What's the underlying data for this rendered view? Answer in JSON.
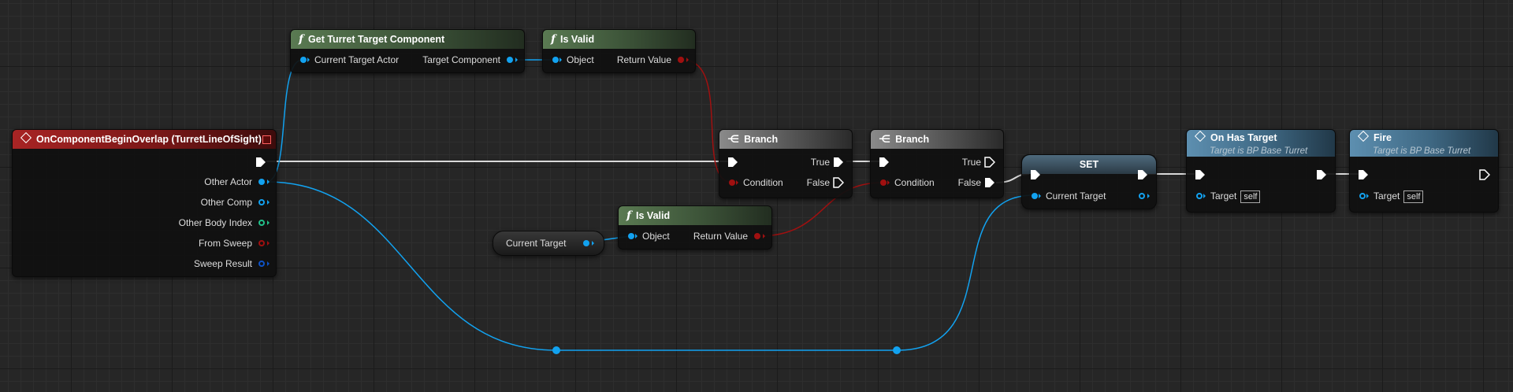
{
  "graph": {
    "event_node": {
      "title": "OnComponentBeginOverlap (TurretLineOfSight)",
      "pins": [
        "Other Actor",
        "Other Comp",
        "Other Body Index",
        "From Sweep",
        "Sweep Result"
      ]
    },
    "get_turret_target": {
      "title": "Get Turret Target Component",
      "input": "Current Target Actor",
      "output": "Target Component"
    },
    "is_valid_top": {
      "title": "Is Valid",
      "input": "Object",
      "output": "Return Value"
    },
    "is_valid_bottom": {
      "title": "Is Valid",
      "input": "Object",
      "output": "Return Value"
    },
    "current_target_var": {
      "label": "Current Target"
    },
    "branch_1": {
      "title": "Branch",
      "condition": "Condition",
      "true": "True",
      "false": "False"
    },
    "branch_2": {
      "title": "Branch",
      "condition": "Condition",
      "true": "True",
      "false": "False"
    },
    "set_node": {
      "title": "SET",
      "pin": "Current Target"
    },
    "on_has_target": {
      "title": "On Has Target",
      "subtitle": "Target is BP Base Turret",
      "target": "Target",
      "self": "self"
    },
    "fire": {
      "title": "Fire",
      "subtitle": "Target is BP Base Turret",
      "target": "Target",
      "self": "self"
    }
  },
  "colors": {
    "exec_wire": "#ffffff",
    "object_wire": "#12a2f0",
    "bool_wire": "#a01010",
    "struct_pin": "#0e52c6",
    "int_pin": "#22c08a",
    "event_header": "#a82424",
    "function_header": "#5a7a52",
    "call_header": "#5d8fb0"
  },
  "icons": {
    "function": "function-f-glyph",
    "event": "event-diamond-icon",
    "branch": "branch-icon"
  }
}
